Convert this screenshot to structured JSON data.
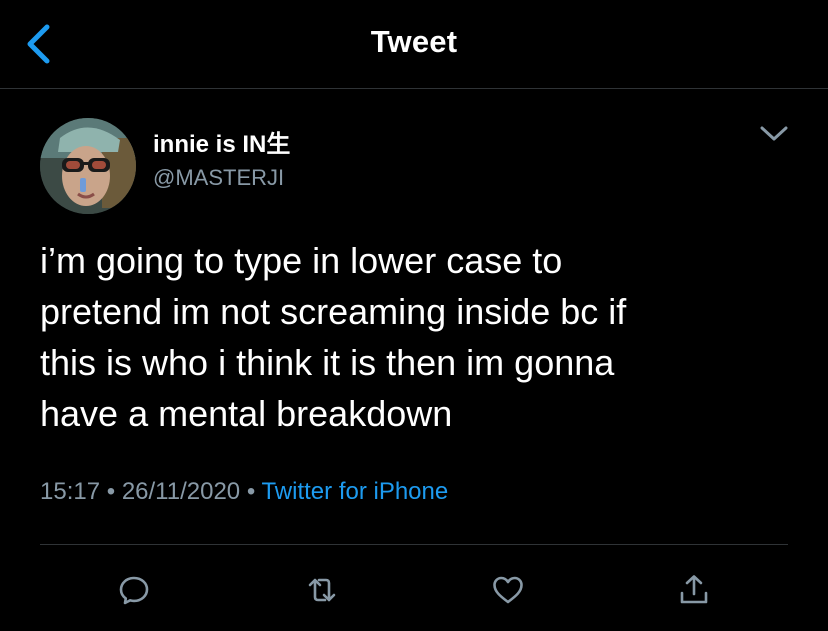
{
  "header": {
    "title": "Tweet",
    "back_icon": "chevron-left-icon"
  },
  "tweet": {
    "author": {
      "display_name": "innie is IN生",
      "handle": "@MASTERJI"
    },
    "text": "i’m going to type in lower case to\npretend im not screaming inside bc if\nthis is who i think it is then im gonna\nhave a mental breakdown",
    "time": "15:17",
    "date": "26/11/2020",
    "separator": "•",
    "source": "Twitter for iPhone"
  },
  "actions": [
    {
      "name": "reply",
      "icon": "reply-icon"
    },
    {
      "name": "retweet",
      "icon": "retweet-icon"
    },
    {
      "name": "like",
      "icon": "heart-icon"
    },
    {
      "name": "share",
      "icon": "share-icon"
    }
  ],
  "colors": {
    "background": "#000000",
    "accent": "#1d9bf0",
    "secondary_text": "#8899a6",
    "divider": "#2f3336"
  }
}
